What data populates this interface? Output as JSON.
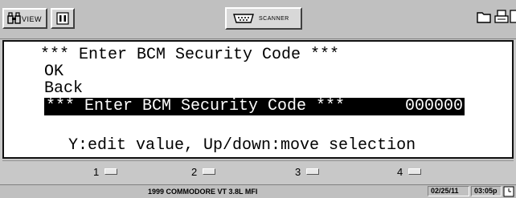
{
  "toolbar": {
    "view_label": "VIEW",
    "scanner_label": "SCANNER",
    "icons": [
      "binoculars-icon",
      "pause-icon",
      "scanner-icon",
      "folder-icon",
      "print-icon",
      "save-icon"
    ]
  },
  "screen": {
    "title": "*** Enter BCM Security Code ***",
    "menu": [
      {
        "label": "OK"
      },
      {
        "label": "Back"
      }
    ],
    "selected": {
      "label": "*** Enter BCM Security Code ***",
      "value": "000000"
    },
    "help": "Y:edit value, Up/down:move selection"
  },
  "fkeys": [
    "1",
    "2",
    "3",
    "4"
  ],
  "status": {
    "vehicle": "1999 COMMODORE VT 3.8L MFI",
    "date": "02/25/11",
    "time": "03:05p"
  },
  "colors": {
    "background": "#c8c8c8",
    "screen": "#ffffff",
    "selection": "#000000"
  }
}
